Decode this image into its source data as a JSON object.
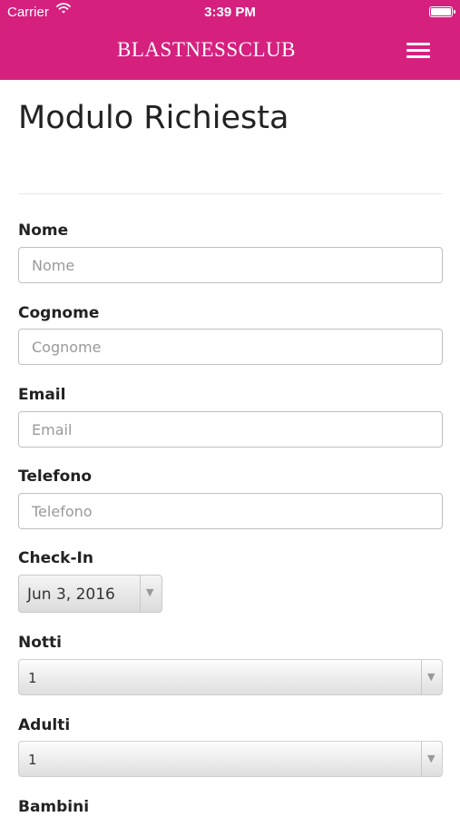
{
  "status_bar": {
    "carrier": "Carrier",
    "time": "3:39 PM"
  },
  "header": {
    "brand": "BLASTNESSCLUB",
    "menu_icon": "hamburger-menu-icon",
    "background_color": "#d5207e"
  },
  "page": {
    "title": "Modulo Richiesta"
  },
  "form": {
    "nome": {
      "label": "Nome",
      "placeholder": "Nome",
      "value": ""
    },
    "cognome": {
      "label": "Cognome",
      "placeholder": "Cognome",
      "value": ""
    },
    "email": {
      "label": "Email",
      "placeholder": "Email",
      "value": ""
    },
    "telefono": {
      "label": "Telefono",
      "placeholder": "Telefono",
      "value": ""
    },
    "checkin": {
      "label": "Check-In",
      "value": "Jun 3, 2016"
    },
    "notti": {
      "label": "Notti",
      "value": "1"
    },
    "adulti": {
      "label": "Adulti",
      "value": "1"
    },
    "bambini": {
      "label": "Bambini"
    }
  }
}
